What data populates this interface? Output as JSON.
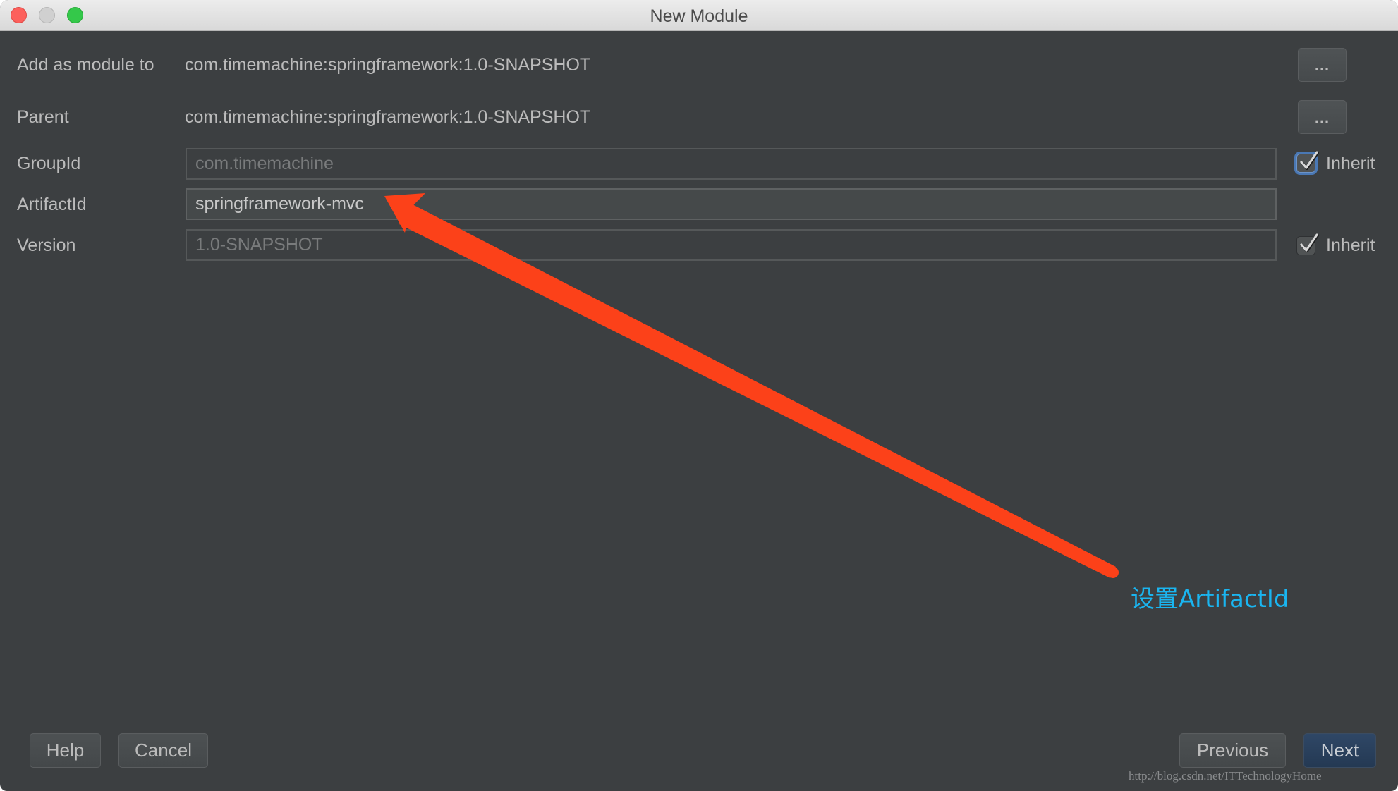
{
  "window": {
    "title": "New Module",
    "controls": [
      "close",
      "minimize",
      "maximize"
    ]
  },
  "form": {
    "add_as_module_to": {
      "label": "Add as module to",
      "value": "com.timemachine:springframework:1.0-SNAPSHOT",
      "browse_label": "..."
    },
    "parent": {
      "label": "Parent",
      "value": "com.timemachine:springframework:1.0-SNAPSHOT",
      "browse_label": "..."
    },
    "group_id": {
      "label": "GroupId",
      "value": "com.timemachine",
      "enabled": false,
      "inherit_label": "Inherit",
      "inherit_checked": true
    },
    "artifact_id": {
      "label": "ArtifactId",
      "value": "springframework-mvc",
      "enabled": true
    },
    "version": {
      "label": "Version",
      "value": "1.0-SNAPSHOT",
      "enabled": false,
      "inherit_label": "Inherit",
      "inherit_checked": true
    }
  },
  "footer": {
    "help_label": "Help",
    "cancel_label": "Cancel",
    "previous_label": "Previous",
    "next_label": "Next"
  },
  "annotation": {
    "text": "设置ArtifactId",
    "arrow_color": "#fc4119",
    "text_color": "#1ab5f0"
  },
  "watermark": "http://blog.csdn.net/ITTechnologyHome"
}
